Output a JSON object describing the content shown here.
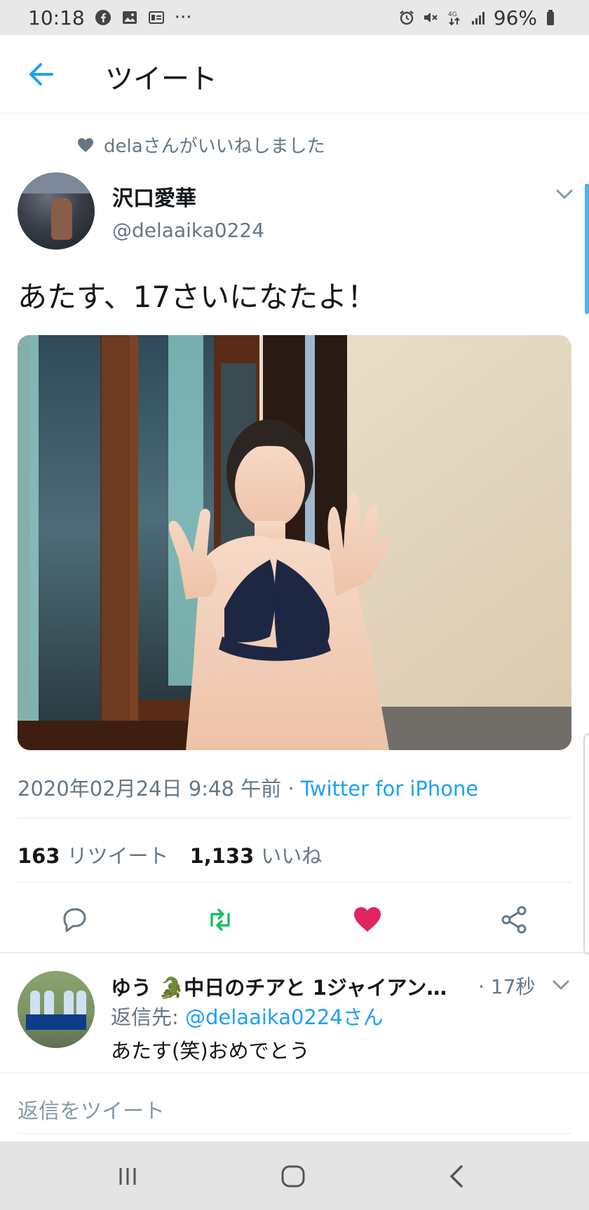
{
  "status_bar": {
    "time": "10:18",
    "battery": "96%",
    "network": "4G",
    "left_icons": [
      "facebook-icon",
      "gallery-icon",
      "notification-card-icon",
      "more-dots-icon"
    ],
    "right_icons": [
      "alarm-icon",
      "mute-icon",
      "data-transfer-icon",
      "signal-icon",
      "battery-icon"
    ]
  },
  "header": {
    "title": "ツイート"
  },
  "tweet": {
    "liked_by": "delaさんがいいねしました",
    "author_name": "沢口愛華",
    "author_handle": "@delaaika0224",
    "text": "あたす、17さいになたよ！",
    "date": "2020年02月24日 9:48 午前",
    "meta_separator": " · ",
    "source": "Twitter for iPhone",
    "retweets_count": "163",
    "retweets_label": "リツイート",
    "likes_count": "1,133",
    "likes_label": "いいね",
    "liked": true
  },
  "reply": {
    "author_name": "ゆう 🐊中日のチアと 1ジャイアン…",
    "time": "· 17秒",
    "reply_to_label": "返信先: ",
    "reply_to_handle": "@delaaika0224さん",
    "text": "あたす(笑)おめでとう"
  },
  "compose": {
    "placeholder": "返信をツイート"
  },
  "colors": {
    "accent": "#1da1f2",
    "retweet": "#17bf63",
    "like": "#e0245e",
    "muted": "#657786"
  }
}
